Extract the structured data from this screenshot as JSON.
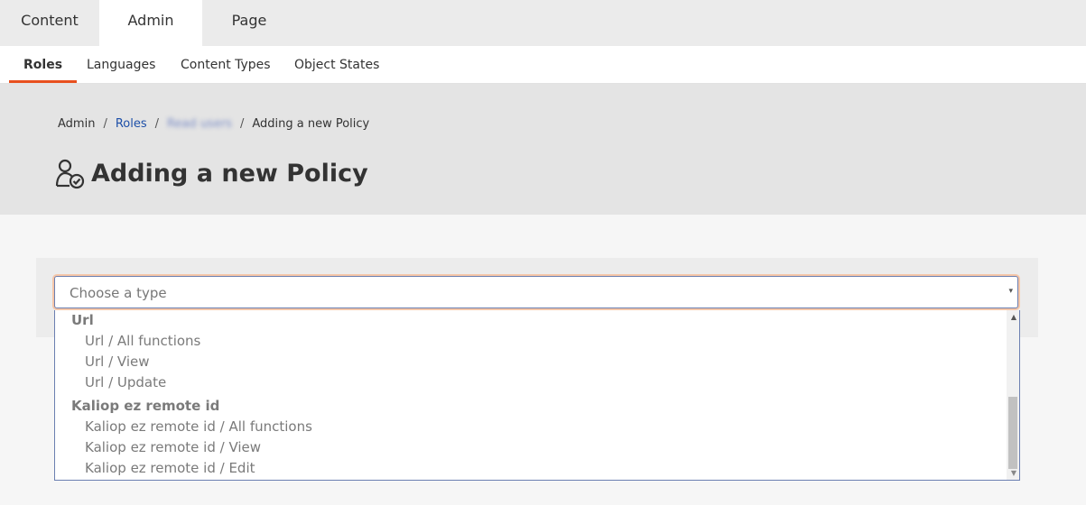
{
  "top_tabs": [
    "Content",
    "Admin",
    "Page"
  ],
  "subnav": [
    "Roles",
    "Languages",
    "Content Types",
    "Object States"
  ],
  "breadcrumb": {
    "root": "Admin",
    "roles": "Roles",
    "role": "Read users",
    "current": "Adding a new Policy",
    "separator": "/"
  },
  "title": "Adding a new Policy",
  "title_icon": "user-check-icon",
  "select": {
    "placeholder": "Choose a type",
    "caret": "▾"
  },
  "dropdown": {
    "options": [
      {
        "type": "group",
        "label": "Url"
      },
      {
        "type": "item",
        "label": "Url / All functions"
      },
      {
        "type": "item",
        "label": "Url / View"
      },
      {
        "type": "item",
        "label": "Url / Update"
      },
      {
        "type": "group",
        "label": "Kaliop ez remote id"
      },
      {
        "type": "item",
        "label": "Kaliop ez remote id / All functions"
      },
      {
        "type": "item",
        "label": "Kaliop ez remote id / View"
      },
      {
        "type": "item",
        "label": "Kaliop ez remote id / Edit"
      }
    ],
    "scroll_up": "▲",
    "scroll_down": "▼"
  },
  "colors": {
    "accent": "#e8501f",
    "link": "#1d4fa8"
  }
}
